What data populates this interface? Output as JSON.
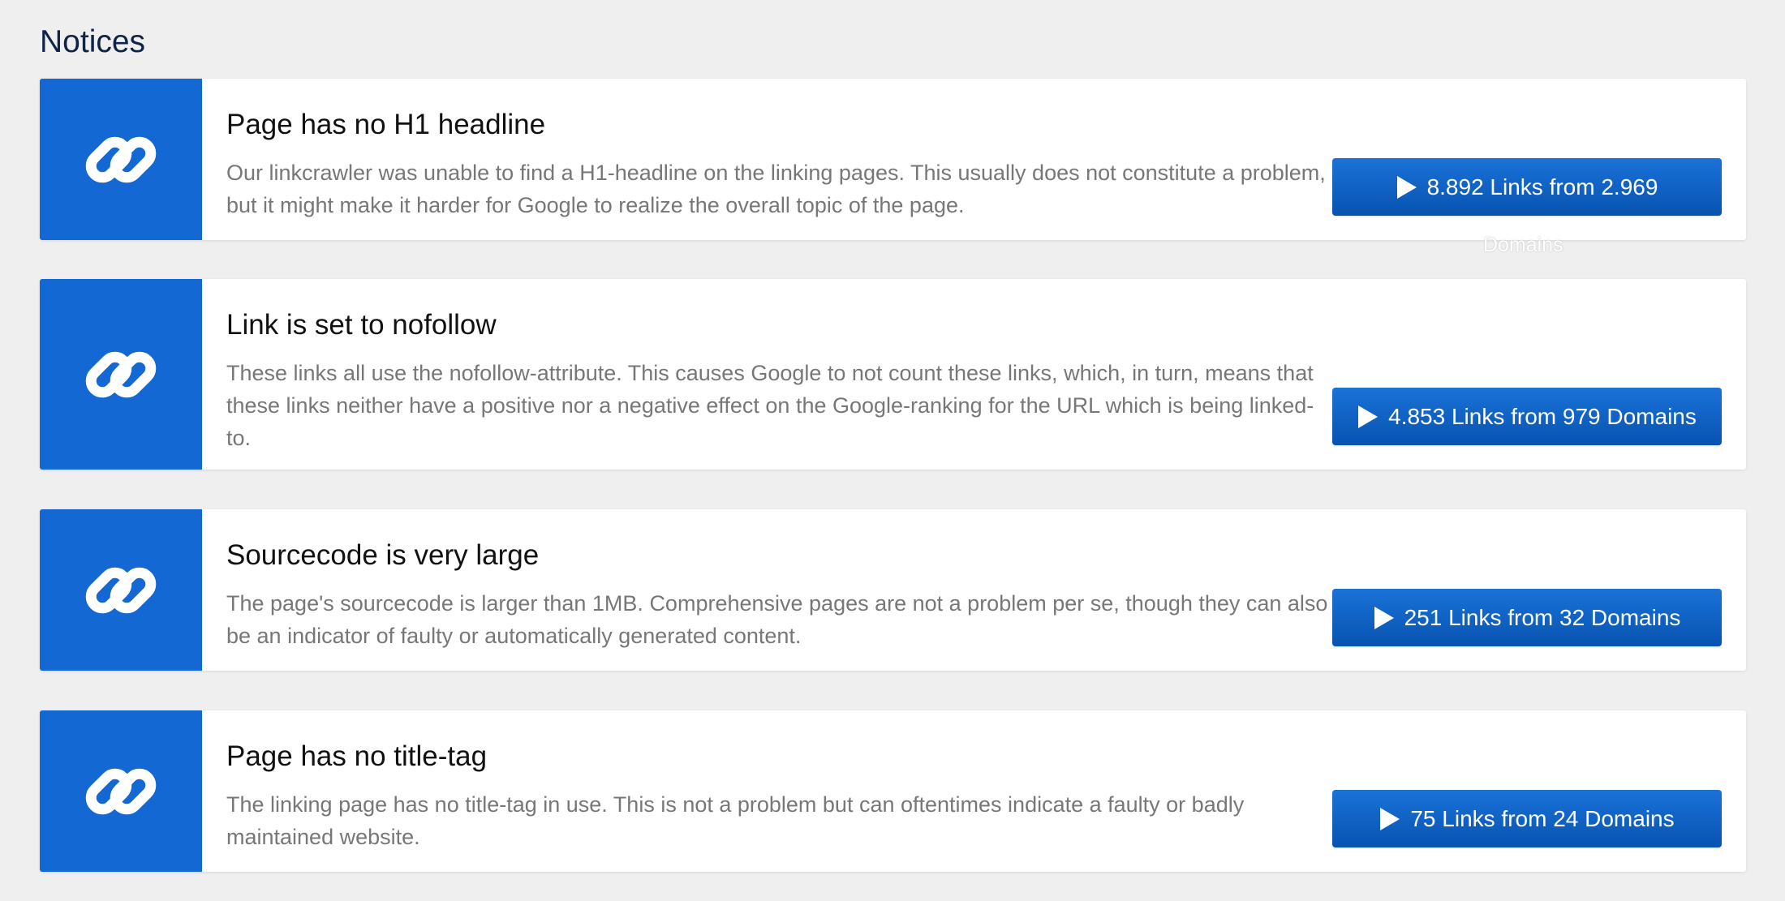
{
  "section": {
    "title": "Notices"
  },
  "icons": {
    "card_icon": "link-icon",
    "button_icon": "play-icon"
  },
  "colors": {
    "accent": "#1468d4",
    "button": "#0a5bbf",
    "page_background": "#efefef",
    "title": "#0f2347",
    "description": "#777777"
  },
  "notices": [
    {
      "title": "Page has no H1 headline",
      "description": "Our linkcrawler was unable to find a H1-headline on the linking pages. This usually does not constitute a problem, but it might make it harder for Google to realize the overall topic of the page.",
      "button_label": "8.892 Links from 2.969",
      "overflow_label": "Domains"
    },
    {
      "title": "Link is set to nofollow",
      "description": "These links all use the nofollow-attribute. This causes Google to not count these links, which, in turn, means that these links neither have a positive nor a negative effect on the Google-ranking for the URL which is being linked-to.",
      "button_label": "4.853 Links from 979 Domains"
    },
    {
      "title": "Sourcecode is very large",
      "description": "The page's sourcecode is larger than 1MB. Comprehensive pages are not a problem per se, though they can also be an indicator of faulty or automatically generated content.",
      "button_label": "251 Links from 32 Domains"
    },
    {
      "title": "Page has no title-tag",
      "description": "The linking page has no title-tag in use. This is not a problem but can oftentimes indicate a faulty or badly maintained website.",
      "button_label": "75 Links from 24 Domains"
    }
  ]
}
